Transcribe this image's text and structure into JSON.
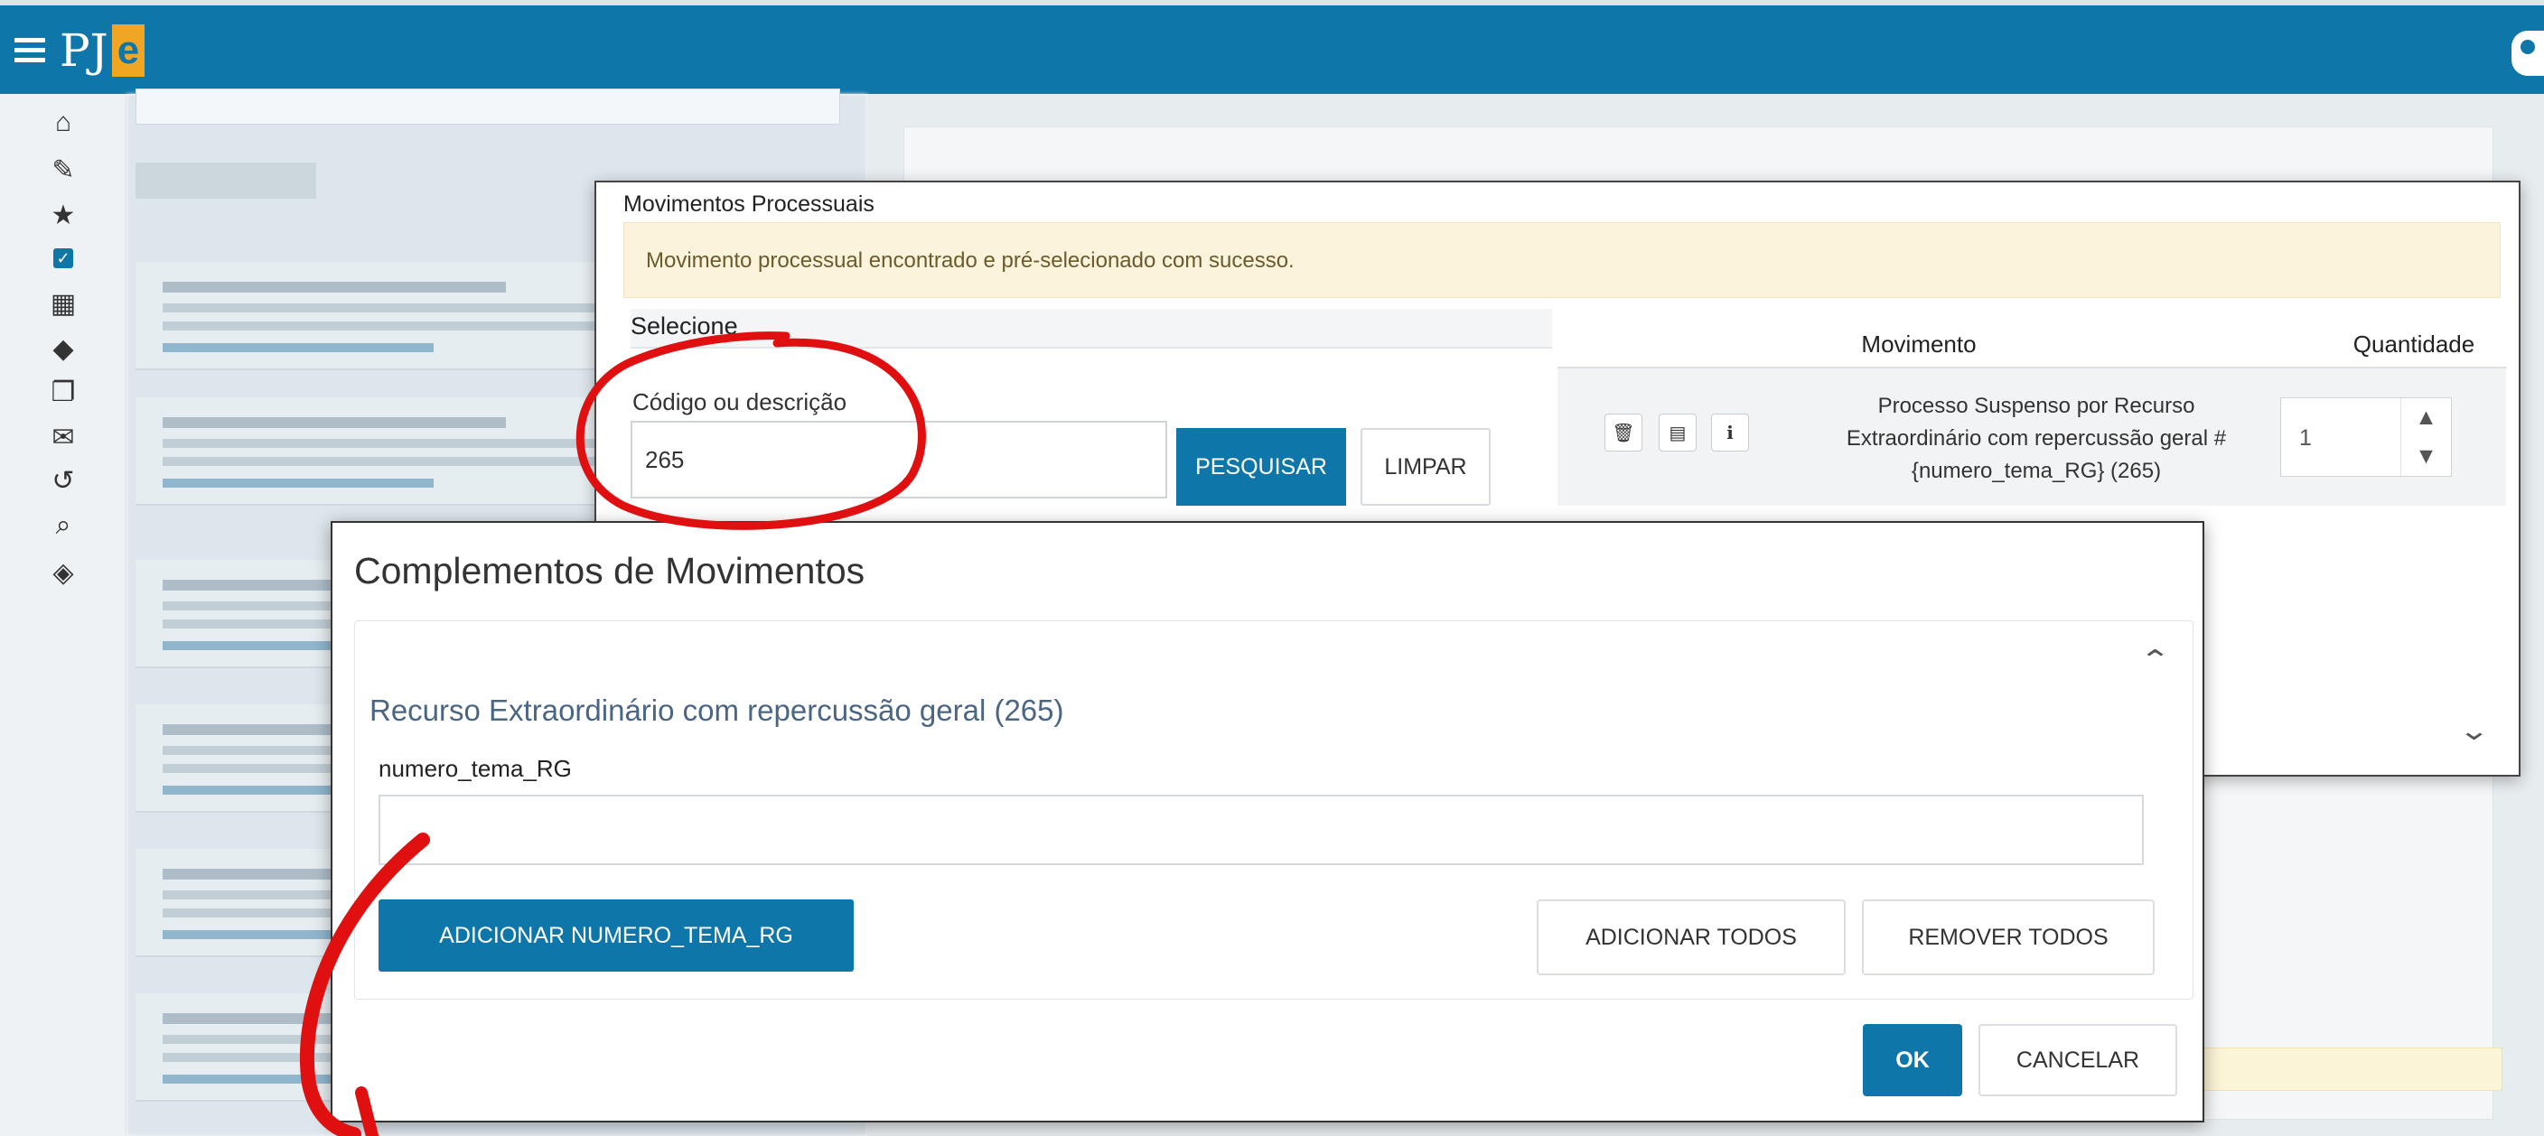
{
  "app": {
    "logo_text": "PJ",
    "logo_highlight": "e"
  },
  "sidebar_icons": [
    "home-icon",
    "pencil-icon",
    "star-icon",
    "checkbox-icon",
    "calendar-icon",
    "tags-icon",
    "copy-icon",
    "envelope-icon",
    "history-icon",
    "search-icon",
    "diamond-arrows-icon"
  ],
  "movimentos_modal": {
    "title": "Movimentos Processuais",
    "alert": "Movimento processual encontrado e pré-selecionado com sucesso.",
    "select_header": "Selecione",
    "code_label": "Código ou descrição",
    "code_value": "265",
    "search_button": "PESQUISAR",
    "clear_button": "LIMPAR",
    "columns": [
      "Movimento",
      "Quantidade"
    ],
    "row": {
      "movement": "Processo Suspenso por Recurso Extraordinário com repercussão geral # {numero_tema_RG} (265)",
      "quantity": "1"
    }
  },
  "complementos_modal": {
    "title": "Complementos de Movimentos",
    "subtitle": "Recurso Extraordinário com repercussão geral (265)",
    "field_label": "numero_tema_RG",
    "field_value": "",
    "add_field_button": "ADICIONAR NUMERO_TEMA_RG",
    "add_all_button": "ADICIONAR TODOS",
    "remove_all_button": "REMOVER TODOS",
    "ok_button": "OK",
    "cancel_button": "CANCELAR"
  },
  "colors": {
    "brand_blue": "#0f76a9",
    "alert_bg": "#fbf3dc",
    "annotation_red": "#e01010"
  }
}
